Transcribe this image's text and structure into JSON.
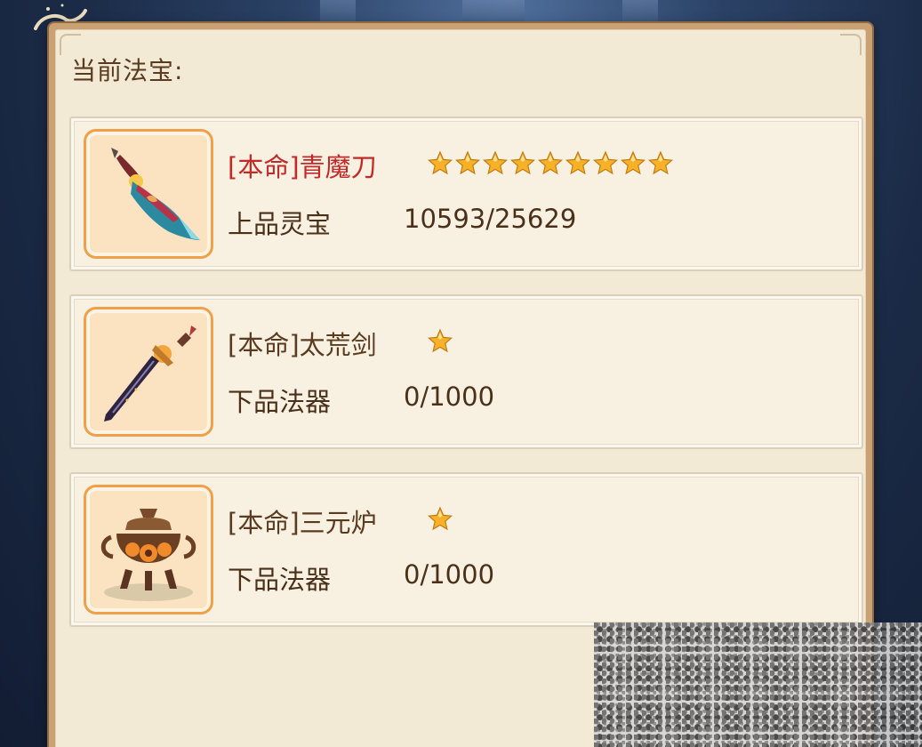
{
  "panel": {
    "title": "当前法宝:"
  },
  "colors": {
    "name_primary": "#c22a2a",
    "name_normal": "#5a3b1f",
    "star_fill": "#f6b126",
    "icon_frame": "#f0a04b"
  },
  "items": [
    {
      "name": "[本命]青魔刀",
      "stars": 9,
      "grade": "上品灵宝",
      "progress": "10593/25629",
      "icon": "blue-demon-saber-icon",
      "highlight": true
    },
    {
      "name": "[本命]太荒剑",
      "stars": 1,
      "grade": "下品法器",
      "progress": "0/1000",
      "icon": "sword-icon",
      "highlight": false
    },
    {
      "name": "[本命]三元炉",
      "stars": 1,
      "grade": "下品法器",
      "progress": "0/1000",
      "icon": "cauldron-icon",
      "highlight": false
    }
  ]
}
